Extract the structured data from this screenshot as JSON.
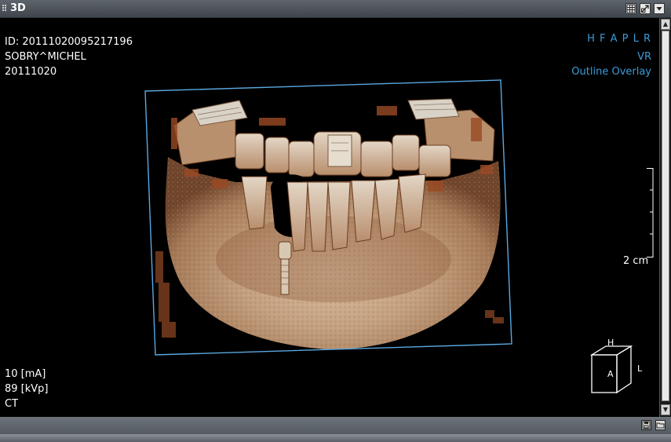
{
  "window": {
    "title": "3D"
  },
  "patient": {
    "id": "ID: 20111020095217196",
    "name": "SOBRY^MICHEL",
    "date": "20111020"
  },
  "orientation_labels": "H F A P L R",
  "render_mode": "VR",
  "overlay_mode": "Outline Overlay",
  "acquisition": {
    "current": "10 [mA]",
    "voltage": "89 [kVp]",
    "modality": "CT"
  },
  "scale_label": "2 cm",
  "cube": {
    "top": "H",
    "side": "L",
    "front": "A"
  },
  "icons": {
    "layout": "grid-layout-icon",
    "maximize": "maximize-icon",
    "menu": "dropdown-menu-icon",
    "save": "save-icon",
    "open": "folder-icon"
  },
  "colors": {
    "overlay_blue": "#3b9bd8",
    "outline": "#5aa8e0",
    "bone": "#c8a987",
    "titlebar": "#4a5056"
  }
}
